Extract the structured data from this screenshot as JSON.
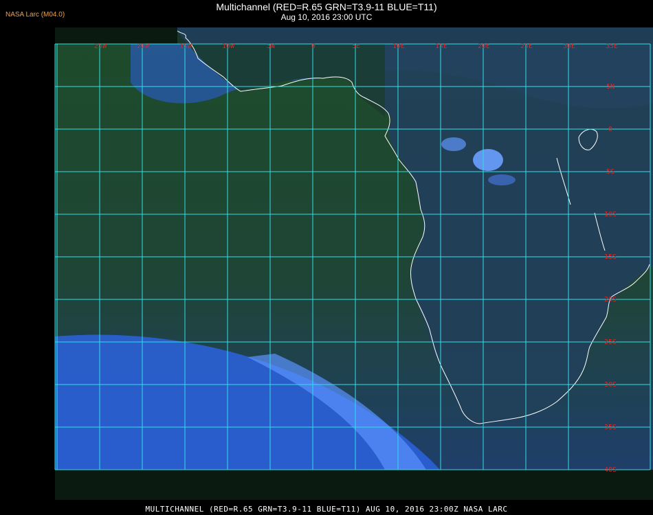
{
  "header": {
    "brand": "NASA Larc (M04.0)",
    "title": "Multichannel (RED=R.65 GRN=T3.9-11 BLUE=T11)",
    "subtitle": "Aug 10, 2016 23:00 UTC"
  },
  "footer": {
    "caption": "MULTICHANNEL (RED=R.65 GRN=T3.9-11 BLUE=T11) AUG 10, 2016 23:00Z   NASA LARC"
  },
  "map": {
    "lon_labels": [
      "25W",
      "20W",
      "15W",
      "10W",
      "5W",
      "0",
      "5E",
      "10E",
      "15E",
      "20E",
      "25E",
      "30E",
      "35E"
    ],
    "lat_labels": [
      "5N",
      "0",
      "5S",
      "10S",
      "15S",
      "20S",
      "25S",
      "30S",
      "35S",
      "40S"
    ],
    "colors": {
      "grid": "#2fe0e8",
      "label": "#d42a2a",
      "coast": "#ffffff",
      "ocean_dark": "#1d4a2a",
      "land": "#23404f",
      "cloud": "#2f6ff0"
    }
  }
}
